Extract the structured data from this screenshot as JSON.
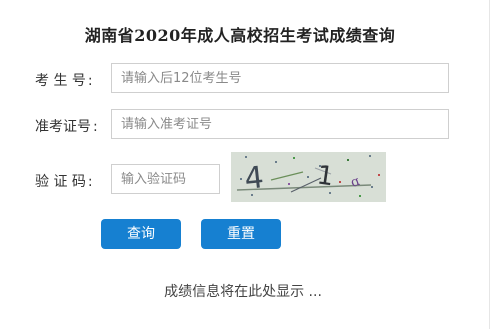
{
  "title": "湖南省2020年成人高校招生考试成绩查询",
  "form": {
    "exam_no": {
      "label": "考 生 号",
      "placeholder": "请输入后12位考生号",
      "value": ""
    },
    "id_no": {
      "label": "准考证号",
      "placeholder": "请输入准考证号",
      "value": ""
    },
    "captcha": {
      "label": "验 证 码",
      "placeholder": "输入验证码",
      "value": "",
      "image_text": "41"
    },
    "colon": ":"
  },
  "buttons": {
    "query": "查询",
    "reset": "重置"
  },
  "result_text": "成绩信息将在此处显示 ...",
  "colors": {
    "button": "#1680d1",
    "captcha_bg": "#d8dfd6"
  }
}
